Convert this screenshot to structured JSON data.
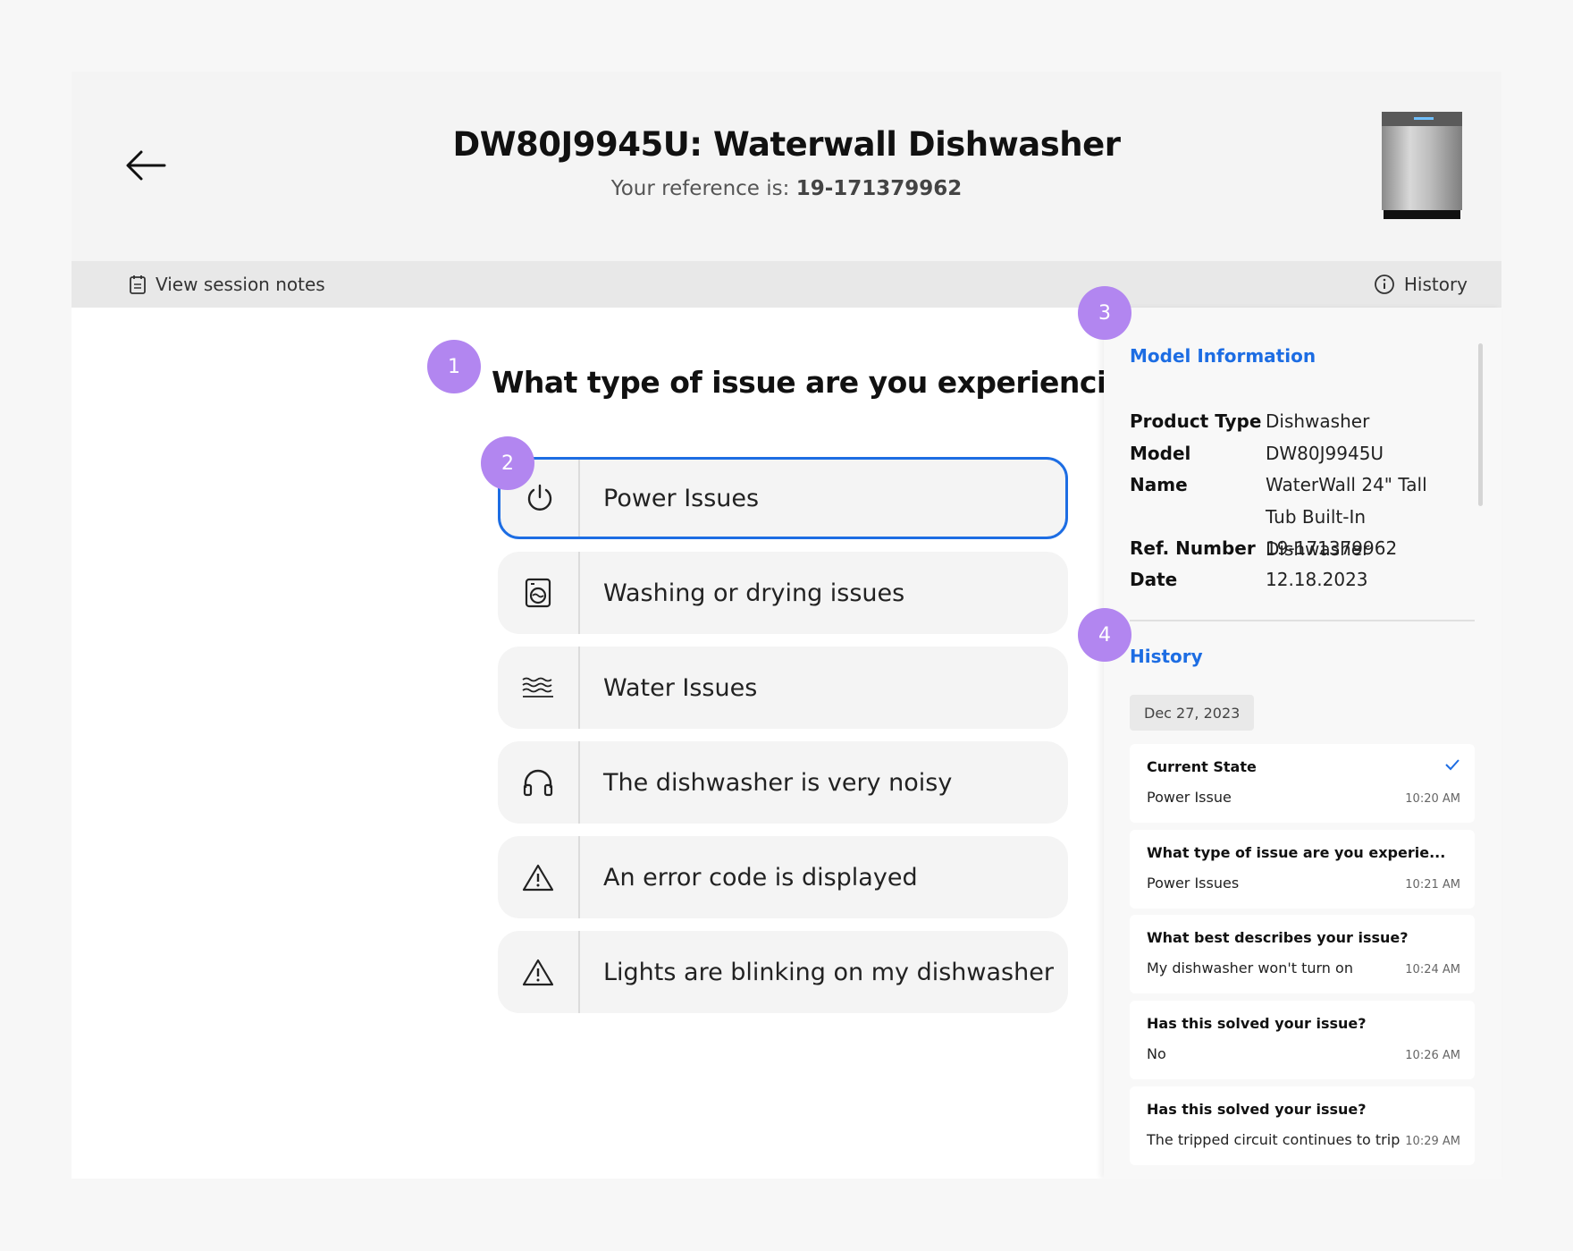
{
  "header": {
    "title": "DW80J9945U: Waterwall Dishwasher",
    "reference_prefix": "Your reference is:",
    "reference_number": "19-171379962"
  },
  "toolbar": {
    "session_notes_label": "View session notes",
    "history_label": "History"
  },
  "question": "What type of issue are you experiencing?",
  "options": [
    {
      "label": "Power Issues",
      "icon": "power-icon",
      "selected": true
    },
    {
      "label": "Washing or drying issues",
      "icon": "washer-icon",
      "selected": false
    },
    {
      "label": "Water Issues",
      "icon": "water-waves-icon",
      "selected": false
    },
    {
      "label": "The dishwasher is very noisy",
      "icon": "headphones-icon",
      "selected": false
    },
    {
      "label": "An error code is displayed",
      "icon": "warning-icon",
      "selected": false
    },
    {
      "label": "Lights are blinking on my dishwasher",
      "icon": "warning-icon",
      "selected": false
    }
  ],
  "sidebar": {
    "model_info_title": "Model Information",
    "model_info": [
      {
        "key": "Product Type",
        "value": "Dishwasher"
      },
      {
        "key": "Model",
        "value": "DW80J9945U"
      },
      {
        "key": "Name",
        "value": "WaterWall 24\" Tall Tub Built-In Dishwasher"
      },
      {
        "key": "Ref. Number",
        "value": "19-171379962"
      },
      {
        "key": "Date",
        "value": "12.18.2023"
      }
    ],
    "history_title": "History",
    "history_date": "Dec 27, 2023",
    "history": [
      {
        "question": "Current State",
        "answer": "Power Issue",
        "time": "10:20 AM",
        "checked": true
      },
      {
        "question": "What type of issue are you experie...",
        "answer": "Power Issues",
        "time": "10:21 AM"
      },
      {
        "question": "What best describes your issue?",
        "answer": "My dishwasher won't turn on",
        "time": "10:24 AM"
      },
      {
        "question": "Has this solved your issue?",
        "answer": "No",
        "time": "10:26 AM"
      },
      {
        "question": "Has this solved your issue?",
        "answer": "The tripped circuit continues to trip",
        "time": "10:29 AM"
      }
    ]
  },
  "annotations": [
    "1",
    "2",
    "3",
    "4"
  ],
  "colors": {
    "accent": "#1d6de3",
    "badge": "#b286f0",
    "header_bg": "#f4f4f4",
    "toolbar_bg": "#e8e8e8"
  }
}
